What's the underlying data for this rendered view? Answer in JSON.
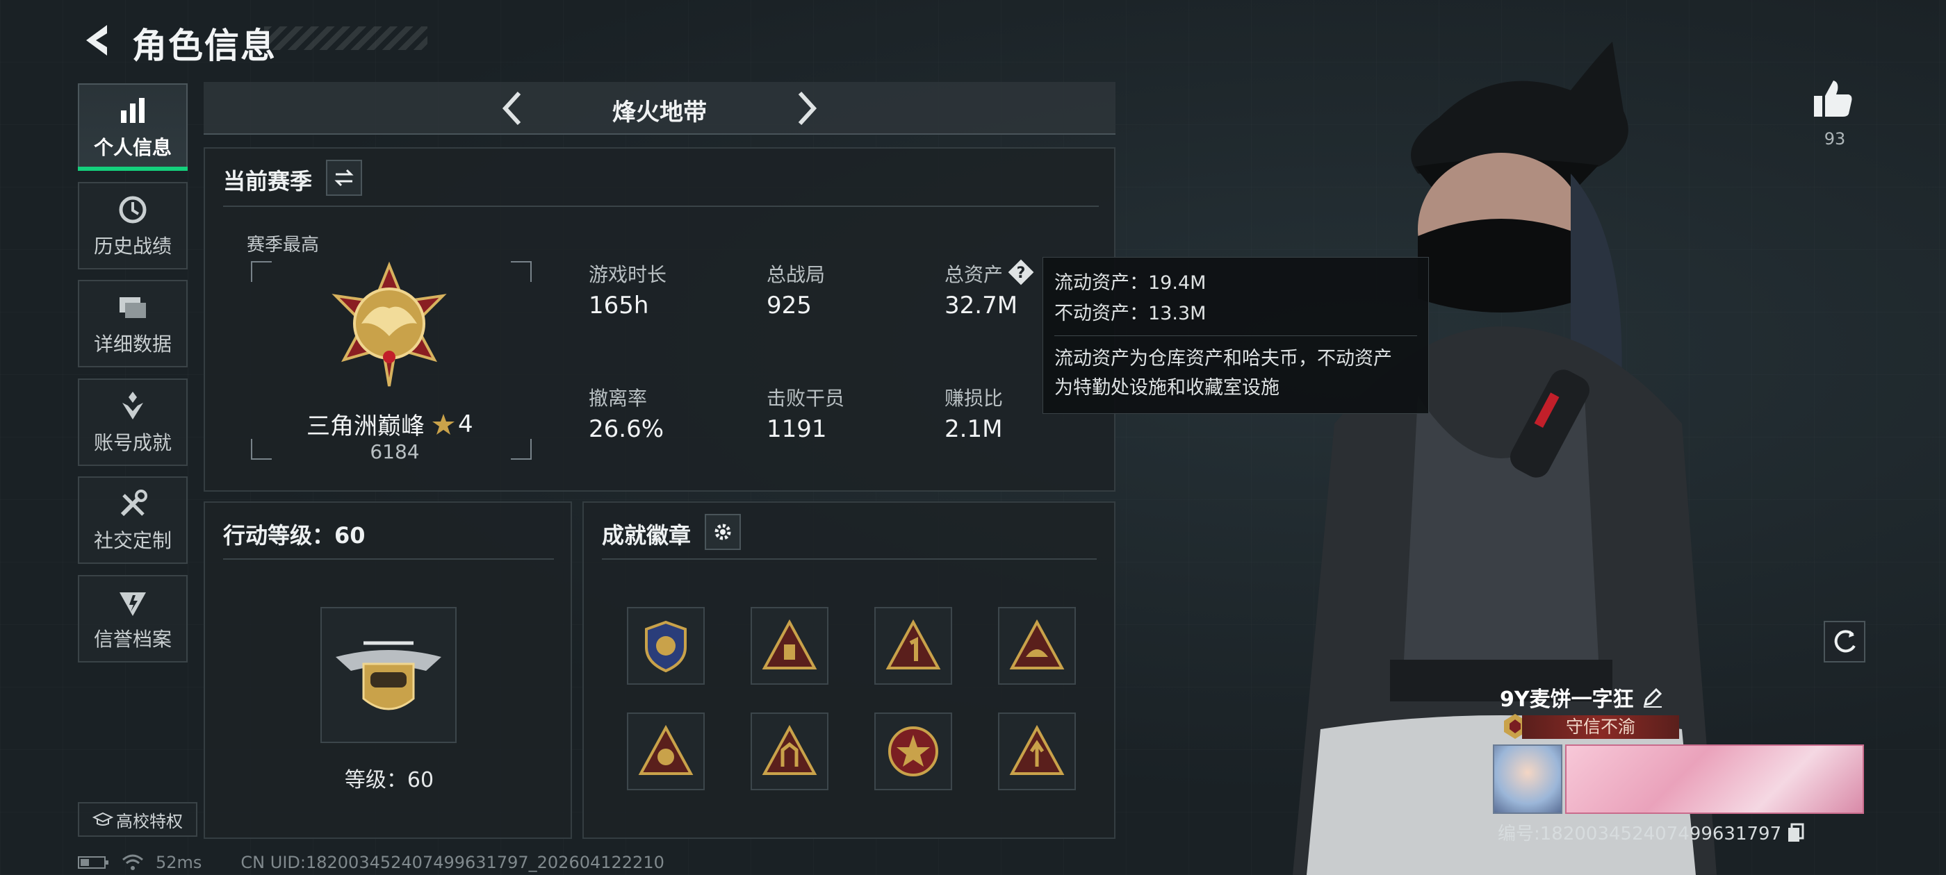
{
  "header": {
    "title": "角色信息"
  },
  "sidebar": {
    "items": [
      {
        "label": "个人信息",
        "icon": "bar-chart-icon",
        "active": true
      },
      {
        "label": "历史战绩",
        "icon": "clock-icon"
      },
      {
        "label": "详细数据",
        "icon": "stack-icon"
      },
      {
        "label": "账号成就",
        "icon": "achievement-icon"
      },
      {
        "label": "社交定制",
        "icon": "tools-icon"
      },
      {
        "label": "信誉档案",
        "icon": "credit-icon"
      }
    ],
    "campus": "高校特权"
  },
  "mode": {
    "name": "烽火地带"
  },
  "season": {
    "title": "当前赛季",
    "best_label": "赛季最高",
    "rank_name": "三角洲巅峰",
    "rank_stars": "4",
    "rank_points": "6184",
    "stats": [
      {
        "label": "游戏时长",
        "value": "165h"
      },
      {
        "label": "总战局",
        "value": "925"
      },
      {
        "label": "总资产",
        "value": "32.7M"
      },
      {
        "label": "撤离率",
        "value": "26.6%"
      },
      {
        "label": "击败干员",
        "value": "1191"
      },
      {
        "label": "赚损比",
        "value": "2.1M"
      }
    ]
  },
  "tooltip": {
    "liquid": "流动资产：19.4M",
    "fixed": "不动资产：13.3M",
    "desc1": "流动资产为仓库资产和哈夫币，不动资产",
    "desc2": "为特勤处设施和收藏室设施"
  },
  "action_level": {
    "title": "行动等级：60",
    "level_text": "等级：60"
  },
  "achievements": {
    "title": "成就徽章",
    "badge_count": 8
  },
  "profile": {
    "likes": "93",
    "name": "9Y麦饼一字狂",
    "title_tag": "守信不渝",
    "id": "编号:182003452407499631797"
  },
  "status": {
    "ping": "52ms",
    "uid": "CN UID:182003452407499631797_202604122210"
  },
  "colors": {
    "accent": "#14d07c",
    "gold": "#c9a24a",
    "tag_red": "#8a2a25"
  }
}
